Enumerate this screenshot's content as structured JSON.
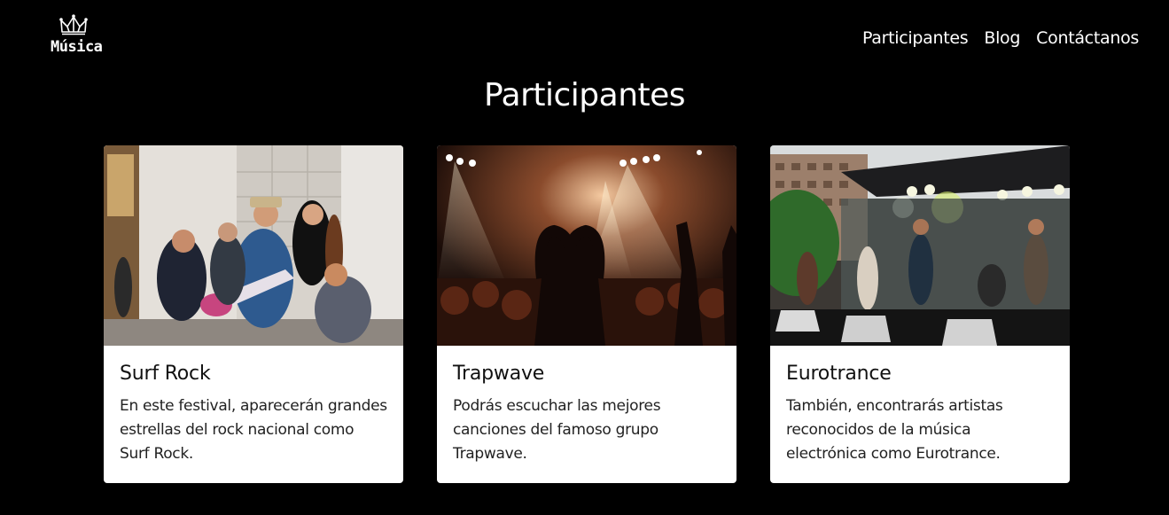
{
  "header": {
    "logo_text": "Música",
    "logo_icon": "crown-icon",
    "nav": [
      {
        "label": "Participantes"
      },
      {
        "label": "Blog"
      },
      {
        "label": "Contáctanos"
      }
    ]
  },
  "main": {
    "title": "Participantes",
    "cards": [
      {
        "title": "Surf Rock",
        "text": "En este festival, aparecerán grandes estrellas del rock nacional como Surf Rock.",
        "image": "street-band-photo"
      },
      {
        "title": "Trapwave",
        "text": "Podrás escuchar las mejores canciones del famoso grupo Trapwave.",
        "image": "concert-crowd-photo"
      },
      {
        "title": "Eurotrance",
        "text": "También, encontrarás artistas reconocidos de la música electrónica como Eurotrance.",
        "image": "outdoor-stage-photo"
      }
    ]
  },
  "colors": {
    "background": "#000000",
    "text_light": "#ffffff",
    "card_bg": "#ffffff",
    "card_text": "#222222"
  }
}
